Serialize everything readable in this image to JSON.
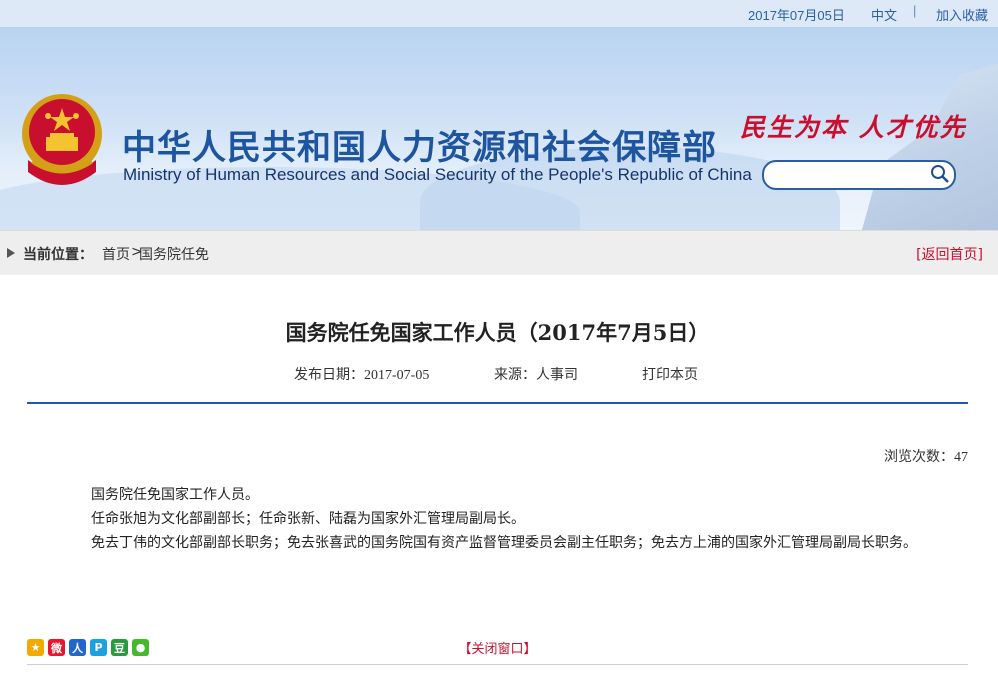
{
  "topbar": {
    "date": "2017年07月05日",
    "language": "中文",
    "separator": "|",
    "favorite": "加入收藏"
  },
  "header": {
    "title_cn": "中华人民共和国人力资源和社会保障部",
    "title_en": "Ministry of Human Resources and Social Security of the People's Republic of China",
    "slogan": "民生为本 人才优先",
    "search": {
      "placeholder": "",
      "value": ""
    }
  },
  "breadcrumb": {
    "label": "当前位置：",
    "home": "首页",
    "separator": ">",
    "current": "国务院任免",
    "back": "[返回首页]"
  },
  "article": {
    "title": "国务院任免国家工作人员（2017年7月5日）",
    "publish_label": "发布日期：",
    "publish_date": "2017-07-05",
    "source_label": "来源：",
    "source": "人事司",
    "print": "打印本页",
    "views_label": "浏览次数：",
    "views": "47",
    "paragraphs": [
      "国务院任免国家工作人员。",
      "任命张旭为文化部副部长；任命张新、陆磊为国家外汇管理局副局长。",
      "免去丁伟的文化部副部长职务；免去张喜武的国务院国有资产监督管理委员会副主任职务；免去方上浦的国家外汇管理局副局长职务。"
    ]
  },
  "share_icons": [
    {
      "name": "qzone-icon",
      "glyph": "★",
      "color": "#f2a900"
    },
    {
      "name": "weibo-icon",
      "glyph": "微",
      "color": "#e6162d"
    },
    {
      "name": "renren-icon",
      "glyph": "人",
      "color": "#2266cc"
    },
    {
      "name": "tencent-weibo-icon",
      "glyph": "P",
      "color": "#1aa1e1"
    },
    {
      "name": "douban-icon",
      "glyph": "豆",
      "color": "#2a9a3f"
    },
    {
      "name": "wechat-icon",
      "glyph": "●",
      "color": "#46b82c"
    }
  ],
  "footer": {
    "close": "【关闭窗口】"
  }
}
